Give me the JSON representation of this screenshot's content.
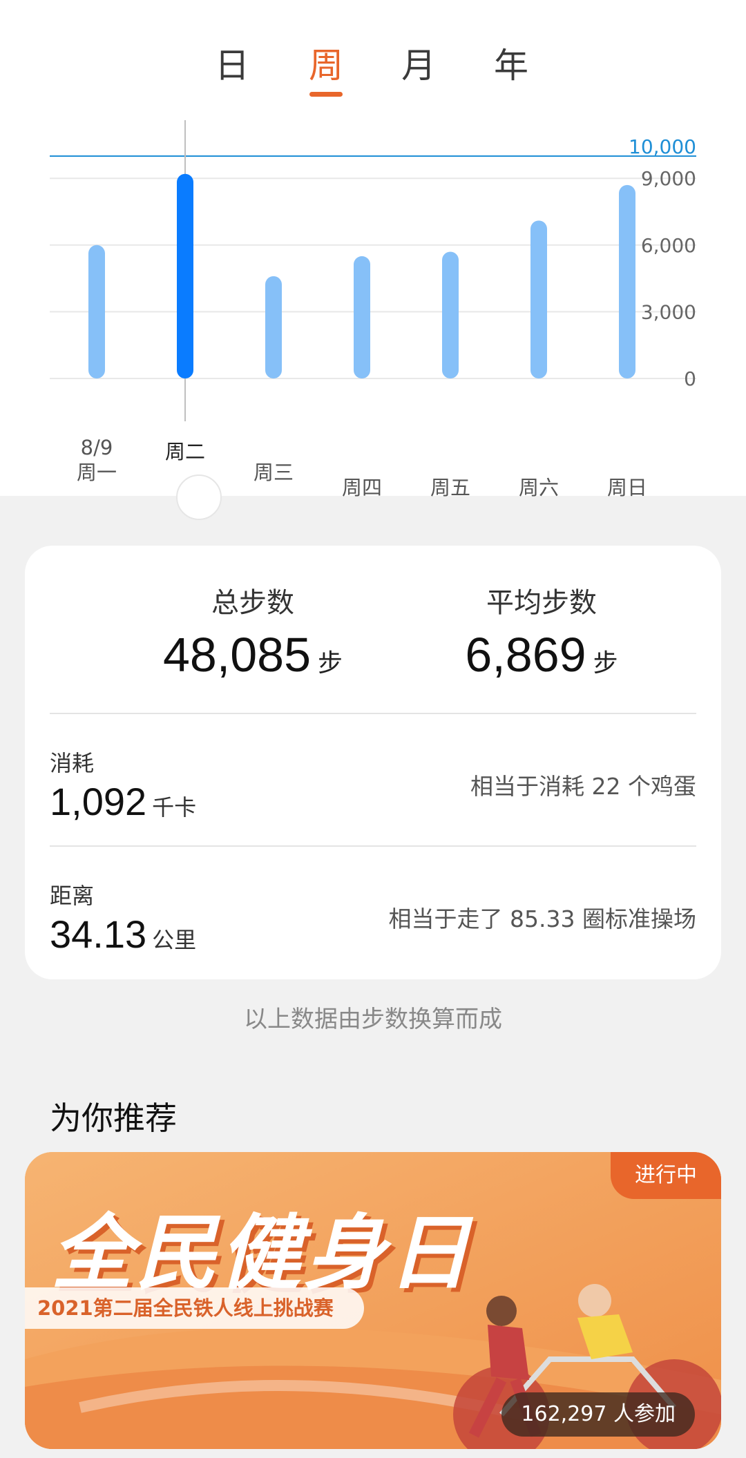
{
  "tabs": [
    {
      "label": "日",
      "active": false
    },
    {
      "label": "周",
      "active": true
    },
    {
      "label": "月",
      "active": false
    },
    {
      "label": "年",
      "active": false
    }
  ],
  "colors": {
    "accent": "#e8662b",
    "bar": "#86c0f8",
    "bar_selected": "#0a7cff",
    "goal_line": "#1f8fd6"
  },
  "chart_data": {
    "type": "bar",
    "categories": [
      "周一",
      "周二",
      "周三",
      "周四",
      "周五",
      "周六",
      "周日"
    ],
    "date_labels": [
      "8/9",
      "",
      "",
      "",
      "",
      "",
      ""
    ],
    "values": [
      6000,
      9200,
      4600,
      5500,
      5700,
      7100,
      8700
    ],
    "selected_index": 1,
    "goal": 10000,
    "goal_label": "10,000",
    "yticks": [
      0,
      3000,
      6000,
      9000
    ],
    "ytick_labels": [
      "0",
      "3,000",
      "6,000",
      "9,000"
    ],
    "ylim": [
      0,
      10000
    ],
    "grid": true
  },
  "stats": {
    "total_title": "总步数",
    "total_value": "48,085",
    "total_unit": "步",
    "avg_title": "平均步数",
    "avg_value": "6,869",
    "avg_unit": "步",
    "calorie_label": "消耗",
    "calorie_value": "1,092",
    "calorie_unit": "千卡",
    "calorie_note": "相当于消耗 22 个鸡蛋",
    "distance_label": "距离",
    "distance_value": "34.13",
    "distance_unit": "公里",
    "distance_note": "相当于走了 85.33 圈标准操场"
  },
  "footnote": "以上数据由步数换算而成",
  "recommend": {
    "title": "为你推荐",
    "banner": {
      "badge": "进行中",
      "title": "全民健身日",
      "subtitle": "2021第二届全民铁人线上挑战赛",
      "participants": "162,297 人参加"
    }
  }
}
